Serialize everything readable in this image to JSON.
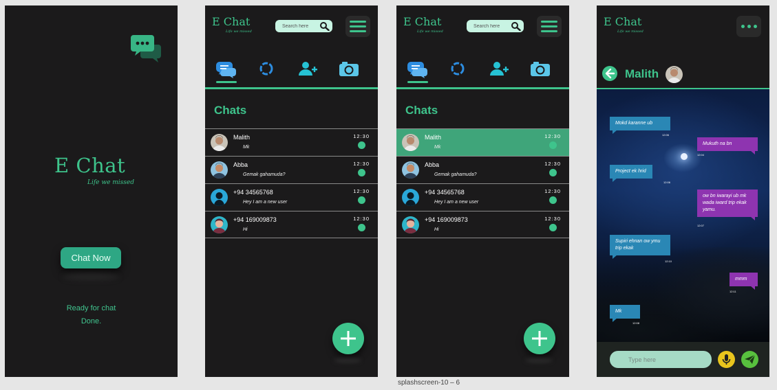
{
  "splash": {
    "title": "E Chat",
    "subtitle": "Life we missed",
    "button_label": "Chat Now",
    "status_line1": "Ready for chat",
    "status_line2": "Done."
  },
  "header": {
    "title": "E Chat",
    "subtitle": "Life we missed",
    "search_placeholder": "Search here"
  },
  "tabs": [
    {
      "icon": "chat-bubbles-icon"
    },
    {
      "icon": "status-ring-icon"
    },
    {
      "icon": "add-contact-icon"
    },
    {
      "icon": "camera-icon"
    }
  ],
  "chats_heading": "Chats",
  "chats": [
    {
      "name": "Malith",
      "message": "Mk",
      "time": "12:30"
    },
    {
      "name": "Abba",
      "message": "Gemak gahamuda?",
      "time": "12:30"
    },
    {
      "name": "+94 34565768",
      "message": "Hey I am a new user",
      "time": "12:30"
    },
    {
      "name": "+94 169009873",
      "message": "Hi",
      "time": "12:30"
    }
  ],
  "conversation": {
    "contact_name": "Malith",
    "input_placeholder": "Type here",
    "messages": [
      {
        "dir": "in",
        "text": "Mokd karanne ub",
        "time": "12:06"
      },
      {
        "dir": "out",
        "text": "Mukuth na bn",
        "time": "12:04"
      },
      {
        "dir": "in",
        "text": "Project ek hrid",
        "time": "12:06"
      },
      {
        "dir": "out",
        "text": "ow bn iwarayi ub mk wada iward trip ekak yamu.",
        "time": "12:07"
      },
      {
        "dir": "in",
        "text": "Supiri ehnan ow ymu trip ekak",
        "time": "12:10"
      },
      {
        "dir": "out",
        "text": "mmm",
        "time": "12:11"
      },
      {
        "dir": "in",
        "text": "Mk",
        "time": "12:08"
      }
    ]
  },
  "caption": "splashscreen-10 – 6",
  "colors": {
    "accent": "#3ec48c",
    "background": "#1b1a1b",
    "incoming": "#2a87b5",
    "outgoing": "#8e34b0"
  }
}
